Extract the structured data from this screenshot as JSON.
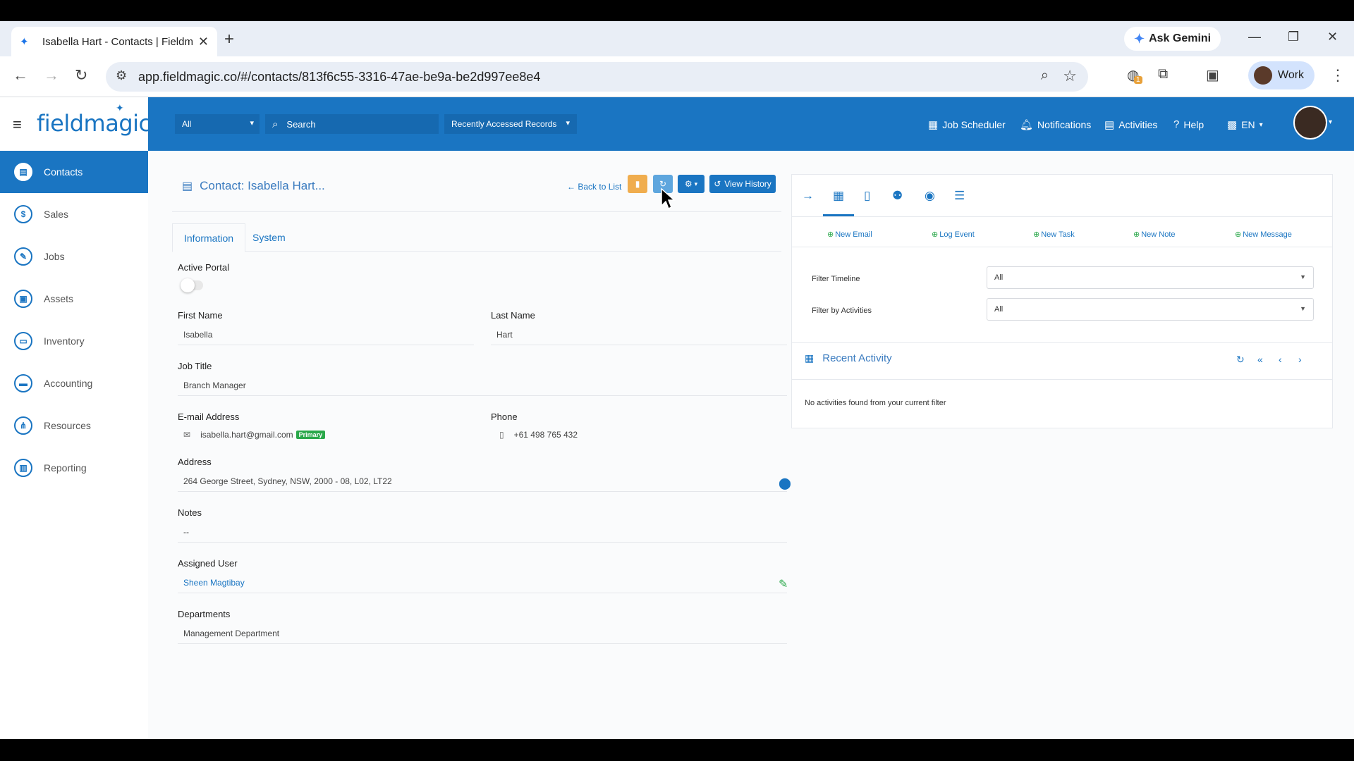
{
  "browser": {
    "tab_title": "Isabella Hart - Contacts | Fieldm",
    "gemini_label": "Ask Gemini",
    "url": "app.fieldmagic.co/#/contacts/813f6c55-3316-47ae-be9a-be2d997ee8e4",
    "extension_badge": "1",
    "profile_label": "Work"
  },
  "header": {
    "logo_text": "fieldmagic",
    "filter_select": "All",
    "search_placeholder": "Search",
    "recent_select": "Recently Accessed Records",
    "links": [
      "Job Scheduler",
      "Notifications",
      "Activities",
      "Help"
    ],
    "language": "EN"
  },
  "sidebar": {
    "items": [
      {
        "label": "Contacts",
        "icon": "contact-book-icon"
      },
      {
        "label": "Sales",
        "icon": "dollar-icon"
      },
      {
        "label": "Jobs",
        "icon": "wrench-icon"
      },
      {
        "label": "Assets",
        "icon": "briefcase-icon"
      },
      {
        "label": "Inventory",
        "icon": "box-icon"
      },
      {
        "label": "Accounting",
        "icon": "credit-card-icon"
      },
      {
        "label": "Resources",
        "icon": "network-icon"
      },
      {
        "label": "Reporting",
        "icon": "report-icon"
      }
    ]
  },
  "contact": {
    "title": "Contact: Isabella Hart...",
    "back_label": "Back to List",
    "view_history_label": "View History",
    "tabs": [
      "Information",
      "System"
    ],
    "fields": {
      "active_portal_label": "Active Portal",
      "first_name_label": "First Name",
      "first_name": "Isabella",
      "last_name_label": "Last Name",
      "last_name": "Hart",
      "job_title_label": "Job Title",
      "job_title": "Branch Manager",
      "email_label": "E-mail Address",
      "email": "isabella.hart@gmail.com",
      "email_badge": "Primary",
      "phone_label": "Phone",
      "phone": "+61 498 765 432",
      "address_label": "Address",
      "address": "264 George Street, Sydney, NSW, 2000 - 08, L02, LT22",
      "notes_label": "Notes",
      "notes": "--",
      "assigned_user_label": "Assigned User",
      "assigned_user": "Sheen Magtibay",
      "departments_label": "Departments",
      "departments": "Management Department"
    }
  },
  "activity_panel": {
    "actions": [
      "New Email",
      "Log Event",
      "New Task",
      "New Note",
      "New Message"
    ],
    "filter_timeline_label": "Filter Timeline",
    "filter_timeline_value": "All",
    "filter_activities_label": "Filter by Activities",
    "filter_activities_value": "All",
    "recent_title": "Recent Activity",
    "empty_message": "No activities found from your current filter"
  },
  "colors": {
    "primary": "#1a75c2",
    "delete": "#f0ad4e",
    "success": "#2aa84a"
  }
}
